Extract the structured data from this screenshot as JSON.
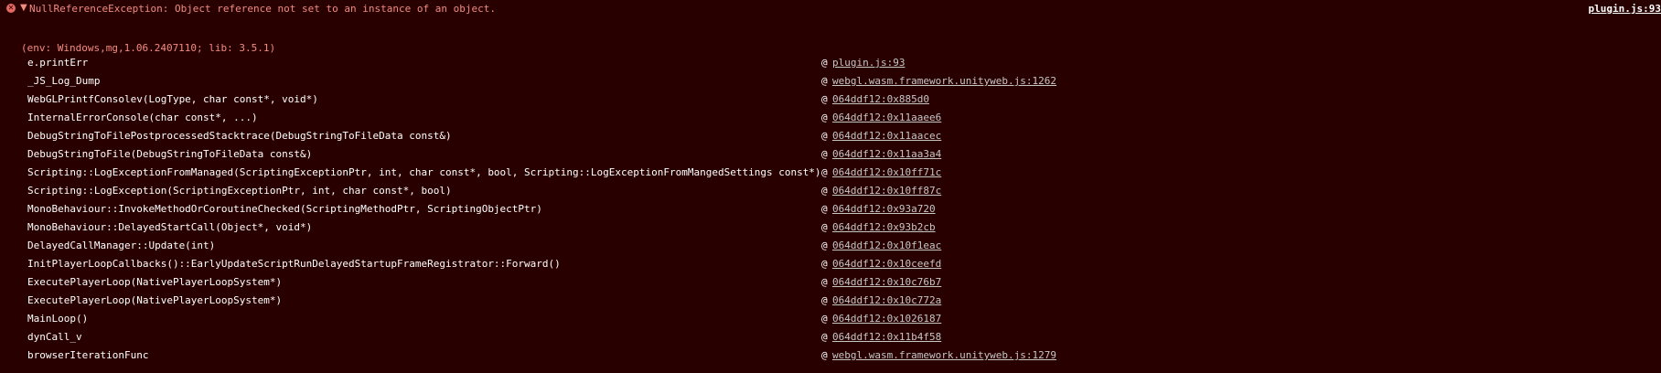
{
  "error": {
    "icon_glyph": "✕",
    "expand_glyph": "▼",
    "message": "NullReferenceException: Object reference not set to an instance of an object.",
    "source": "plugin.js:93"
  },
  "env_line": "(env: Windows,mg,1.06.2407110; lib: 3.5.1)",
  "at_symbol": "@",
  "stack": [
    {
      "fn": "e.printErr",
      "loc": "plugin.js:93"
    },
    {
      "fn": "_JS_Log_Dump",
      "loc": "webgl.wasm.framework.unityweb.js:1262"
    },
    {
      "fn": "WebGLPrintfConsolev(LogType, char const*, void*)",
      "loc": "064ddf12:0x885d0"
    },
    {
      "fn": "InternalErrorConsole(char const*, ...)",
      "loc": "064ddf12:0x11aaee6"
    },
    {
      "fn": "DebugStringToFilePostprocessedStacktrace(DebugStringToFileData const&)",
      "loc": "064ddf12:0x11aacec"
    },
    {
      "fn": "DebugStringToFile(DebugStringToFileData const&)",
      "loc": "064ddf12:0x11aa3a4"
    },
    {
      "fn": "Scripting::LogExceptionFromManaged(ScriptingExceptionPtr, int, char const*, bool, Scripting::LogExceptionFromMangedSettings const*)",
      "loc": "064ddf12:0x10ff71c"
    },
    {
      "fn": "Scripting::LogException(ScriptingExceptionPtr, int, char const*, bool)",
      "loc": "064ddf12:0x10ff87c"
    },
    {
      "fn": "MonoBehaviour::InvokeMethodOrCoroutineChecked(ScriptingMethodPtr, ScriptingObjectPtr)",
      "loc": "064ddf12:0x93a720"
    },
    {
      "fn": "MonoBehaviour::DelayedStartCall(Object*, void*)",
      "loc": "064ddf12:0x93b2cb"
    },
    {
      "fn": "DelayedCallManager::Update(int)",
      "loc": "064ddf12:0x10f1eac"
    },
    {
      "fn": "InitPlayerLoopCallbacks()::EarlyUpdateScriptRunDelayedStartupFrameRegistrator::Forward()",
      "loc": "064ddf12:0x10ceefd"
    },
    {
      "fn": "ExecutePlayerLoop(NativePlayerLoopSystem*)",
      "loc": "064ddf12:0x10c76b7"
    },
    {
      "fn": "ExecutePlayerLoop(NativePlayerLoopSystem*)",
      "loc": "064ddf12:0x10c772a"
    },
    {
      "fn": "MainLoop()",
      "loc": "064ddf12:0x1026187"
    },
    {
      "fn": "dynCall_v",
      "loc": "064ddf12:0x11b4f58"
    },
    {
      "fn": "browserIterationFunc",
      "loc": "webgl.wasm.framework.unityweb.js:1279"
    }
  ]
}
